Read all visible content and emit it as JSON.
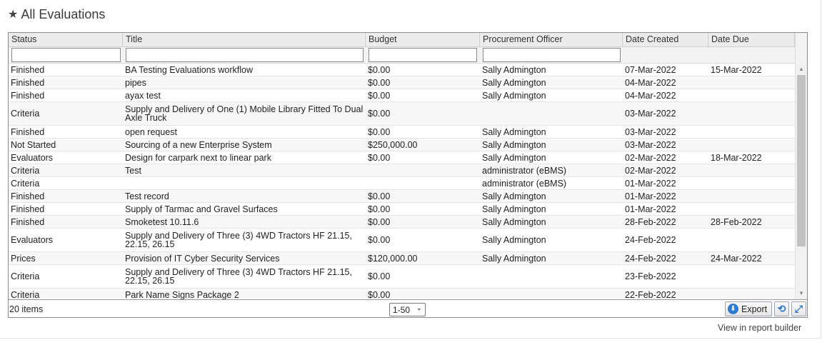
{
  "heading": {
    "title": "All Evaluations",
    "icon": "star-icon"
  },
  "columns": [
    "Status",
    "Title",
    "Budget",
    "Procurement Officer",
    "Date Created",
    "Date Due"
  ],
  "rows": [
    {
      "status": "Finished",
      "title": "BA Testing Evaluations workflow",
      "budget": "$0.00",
      "officer": "Sally Admington",
      "created": "07-Mar-2022",
      "due": "15-Mar-2022"
    },
    {
      "status": "Finished",
      "title": "pipes",
      "budget": "$0.00",
      "officer": "Sally Admington",
      "created": "04-Mar-2022",
      "due": ""
    },
    {
      "status": "Finished",
      "title": "ayax test",
      "budget": "$0.00",
      "officer": "Sally Admington",
      "created": "04-Mar-2022",
      "due": ""
    },
    {
      "status": "Criteria",
      "title": "Supply and Delivery of One (1) Mobile Library Fitted To Dual Axle Truck",
      "budget": "$0.00",
      "officer": "",
      "created": "03-Mar-2022",
      "due": ""
    },
    {
      "status": "Finished",
      "title": "open request",
      "budget": "$0.00",
      "officer": "Sally Admington",
      "created": "03-Mar-2022",
      "due": ""
    },
    {
      "status": "Not Started",
      "title": "Sourcing of a new Enterprise System",
      "budget": "$250,000.00",
      "officer": "Sally Admington",
      "created": "03-Mar-2022",
      "due": ""
    },
    {
      "status": "Evaluators",
      "title": "Design for carpark next to linear park",
      "budget": "$0.00",
      "officer": "Sally Admington",
      "created": "02-Mar-2022",
      "due": "18-Mar-2022"
    },
    {
      "status": "Criteria",
      "title": "Test",
      "budget": "",
      "officer": "administrator (eBMS)",
      "created": "02-Mar-2022",
      "due": ""
    },
    {
      "status": "Criteria",
      "title": "",
      "budget": "",
      "officer": "administrator (eBMS)",
      "created": "01-Mar-2022",
      "due": ""
    },
    {
      "status": "Finished",
      "title": "Test record",
      "budget": "$0.00",
      "officer": "Sally Admington",
      "created": "01-Mar-2022",
      "due": ""
    },
    {
      "status": "Finished",
      "title": "Supply of Tarmac and Gravel Surfaces",
      "budget": "$0.00",
      "officer": "Sally Admington",
      "created": "01-Mar-2022",
      "due": ""
    },
    {
      "status": "Finished",
      "title": "Smoketest 10.11.6",
      "budget": "$0.00",
      "officer": "Sally Admington",
      "created": "28-Feb-2022",
      "due": "28-Feb-2022"
    },
    {
      "status": "Evaluators",
      "title": "Supply and Delivery of Three (3) 4WD Tractors HF 21.15, 22.15, 26.15",
      "budget": "$0.00",
      "officer": "Sally Admington",
      "created": "24-Feb-2022",
      "due": ""
    },
    {
      "status": "Prices",
      "title": "Provision of IT Cyber Security Services",
      "budget": "$120,000.00",
      "officer": "Sally Admington",
      "created": "24-Feb-2022",
      "due": "24-Mar-2022"
    },
    {
      "status": "Criteria",
      "title": "Supply and Delivery of Three (3) 4WD Tractors HF 21.15, 22.15, 26.15",
      "budget": "$0.00",
      "officer": "",
      "created": "23-Feb-2022",
      "due": ""
    },
    {
      "status": "Criteria",
      "title": "Park Name Signs  Package 2",
      "budget": "$0.00",
      "officer": "",
      "created": "22-Feb-2022",
      "due": ""
    }
  ],
  "footer": {
    "items_count": "20 items",
    "pager_value": "1-50",
    "export_label": "Export"
  },
  "report_link": "View in report builder"
}
